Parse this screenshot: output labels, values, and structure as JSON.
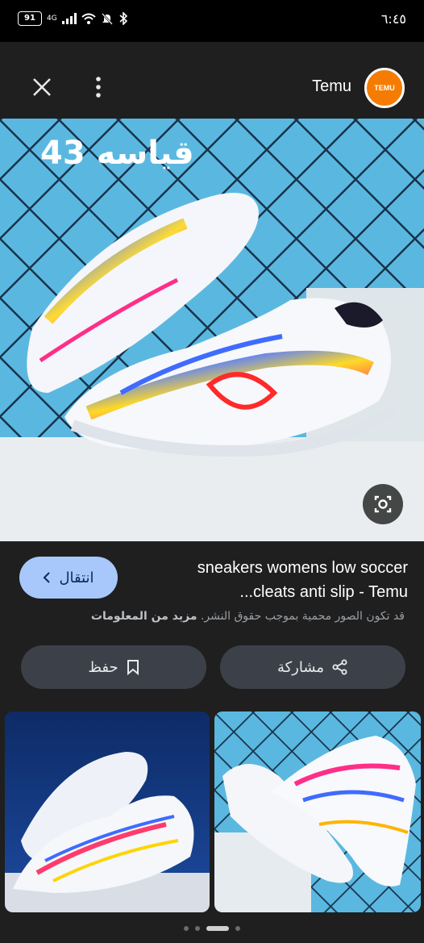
{
  "status_bar": {
    "battery": "91",
    "network": "4G",
    "time": "٦:٤٥"
  },
  "header": {
    "site_name": "Temu",
    "logo_text": "TEMU",
    "close_icon": "close-icon",
    "more_icon": "more-vert-icon"
  },
  "hero": {
    "overlay_text": "قياسه 43",
    "lens_icon": "google-lens-icon"
  },
  "result": {
    "title_line1": "sneakers womens low soccer",
    "title_line2": "...cleats anti slip - Temu",
    "visit_label": "انتقال",
    "copyright_text": "قد تكون الصور محمية بموجب حقوق النشر.",
    "more_info_link": "مزيد من المعلومات"
  },
  "actions": {
    "save_label": "حفظ",
    "share_label": "مشاركة"
  },
  "pagination": {
    "pages": 4,
    "active_index": 2
  },
  "colors": {
    "background": "#1f1f1f",
    "visit_button": "#a8c7fa",
    "pill_button": "#3c4149",
    "logo": "#f57c00"
  }
}
